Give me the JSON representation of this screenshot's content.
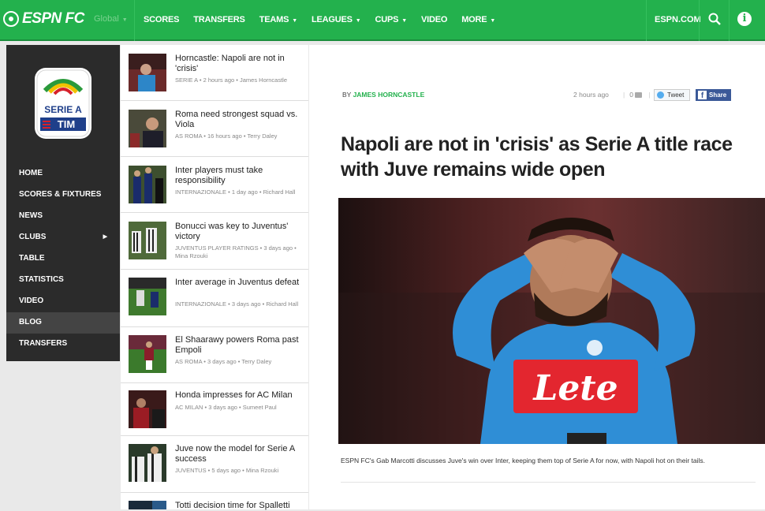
{
  "nav": {
    "logo": "ESPN FC",
    "edition": "Global",
    "links": [
      "SCORES",
      "TRANSFERS",
      "TEAMS",
      "LEAGUES",
      "CUPS",
      "VIDEO",
      "MORE"
    ],
    "espn_com": "ESPN.COM",
    "search_icon": "search-icon",
    "info_icon": "info-icon",
    "info_glyph": "i"
  },
  "sidebar": {
    "logo_text": "SERIE A",
    "logo_sub": "TIM",
    "items": [
      {
        "label": "HOME"
      },
      {
        "label": "SCORES & FIXTURES"
      },
      {
        "label": "NEWS"
      },
      {
        "label": "CLUBS"
      },
      {
        "label": "TABLE"
      },
      {
        "label": "STATISTICS"
      },
      {
        "label": "VIDEO"
      },
      {
        "label": "BLOG"
      },
      {
        "label": "TRANSFERS"
      }
    ],
    "active": "BLOG"
  },
  "feed": [
    {
      "title": "Horncastle: Napoli are not in 'crisis'",
      "tag": "SERIE A",
      "time": "2 hours ago",
      "author": "James Horncastle"
    },
    {
      "title": "Roma need strongest squad vs. Viola",
      "tag": "AS ROMA",
      "time": "16 hours ago",
      "author": "Terry Daley"
    },
    {
      "title": "Inter players must take responsibility",
      "tag": "INTERNAZIONALE",
      "time": "1 day ago",
      "author": "Richard Hall"
    },
    {
      "title": "Bonucci was key to Juventus' victory",
      "tag": "JUVENTUS PLAYER RATINGS",
      "time": "3 days ago",
      "author": "Mina Rzouki"
    },
    {
      "title": "Inter average in Juventus defeat",
      "tag": "INTERNAZIONALE",
      "time": "3 days ago",
      "author": "Richard Hall"
    },
    {
      "title": "El Shaarawy powers Roma past Empoli",
      "tag": "AS ROMA",
      "time": "3 days ago",
      "author": "Terry Daley"
    },
    {
      "title": "Honda impresses for AC Milan",
      "tag": "AC MILAN",
      "time": "3 days ago",
      "author": "Sumeet Paul"
    },
    {
      "title": "Juve now the model for Serie A success",
      "tag": "JUVENTUS",
      "time": "5 days ago",
      "author": "Mina Rzouki"
    },
    {
      "title": "Totti decision time for Spalletti",
      "tag": "",
      "time": "",
      "author": ""
    }
  ],
  "article": {
    "by": "BY",
    "author": "JAMES HORNCASTLE",
    "time": "2 hours ago",
    "comments": "0",
    "tweet": "Tweet",
    "share": "Share",
    "share_glyph": "f",
    "headline": "Napoli are not in 'crisis' as Serie A title race with Juve remains wide open",
    "sponsor_text": "Lete",
    "caption": "ESPN FC's Gab Marcotti discusses Juve's win over Inter, keeping them top of Serie A for now, with Napoli hot on their tails."
  },
  "colors": {
    "brand_green": "#23b14d",
    "sidebar_bg": "#2b2b2b",
    "facebook": "#3b5998",
    "twitter": "#55acee"
  }
}
